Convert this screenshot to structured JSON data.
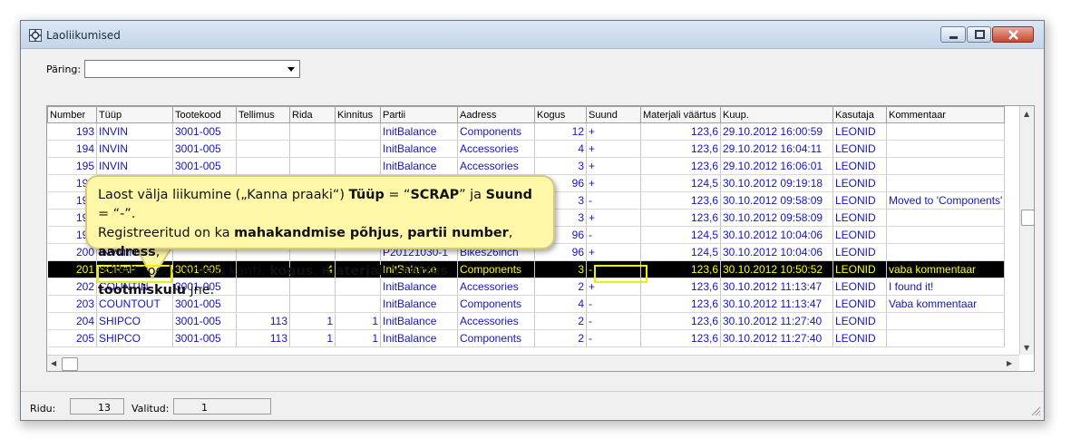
{
  "window": {
    "title": "Laoliikumised"
  },
  "query": {
    "label": "Päring:",
    "value": ""
  },
  "table": {
    "columns": [
      "Number",
      "Tüüp",
      "Tootekood",
      "Tellimus",
      "Rida",
      "Kinnitus",
      "Partii",
      "Aadress",
      "Kogus",
      "Suund",
      "Materjali väärtus",
      "Kuup.",
      "Kasutaja",
      "Kommentaar"
    ],
    "rows": [
      [
        "193",
        "INVIN",
        "3001-005",
        "",
        "",
        "",
        "InitBalance",
        "Components",
        "12",
        "+",
        "123,6",
        "29.10.2012 16:00:59",
        "LEONID",
        ""
      ],
      [
        "194",
        "INVIN",
        "3001-005",
        "",
        "",
        "",
        "InitBalance",
        "Accessories",
        "4",
        "+",
        "123,6",
        "29.10.2012 16:04:11",
        "LEONID",
        ""
      ],
      [
        "195",
        "INVIN",
        "3001-005",
        "",
        "",
        "",
        "InitBalance",
        "Accessories",
        "3",
        "+",
        "123,6",
        "29.10.2012 16:06:01",
        "LEONID",
        ""
      ],
      [
        "196",
        "",
        "",
        "",
        "",
        "",
        "",
        "",
        "96",
        "+",
        "124,5",
        "30.10.2012 09:19:18",
        "LEONID",
        ""
      ],
      [
        "197",
        "",
        "",
        "",
        "",
        "",
        "",
        "",
        "3",
        "-",
        "123,6",
        "30.10.2012 09:58:09",
        "LEONID",
        "Moved to 'Components'"
      ],
      [
        "198",
        "",
        "",
        "",
        "",
        "",
        "",
        "",
        "3",
        "+",
        "123,6",
        "30.10.2012 09:58:09",
        "LEONID",
        ""
      ],
      [
        "199",
        "",
        "",
        "",
        "",
        "",
        "",
        "",
        "96",
        "-",
        "124,5",
        "30.10.2012 10:04:06",
        "LEONID",
        ""
      ],
      [
        "200",
        "INVMIN",
        "",
        "",
        "",
        "",
        "P20121030-1",
        "Bikes26inch",
        "96",
        "+",
        "124,5",
        "30.10.2012 10:04:06",
        "LEONID",
        ""
      ],
      [
        "201",
        "SCRAP",
        "3001-005",
        "",
        "4",
        "",
        "InitBalance",
        "Components",
        "3",
        "-",
        "123,6",
        "30.10.2012 10:50:52",
        "LEONID",
        "vaba kommentaar"
      ],
      [
        "202",
        "COUNTIN",
        "3001-005",
        "",
        "",
        "",
        "InitBalance",
        "Accessories",
        "2",
        "+",
        "123,6",
        "30.10.2012 11:13:47",
        "LEONID",
        "I found it!"
      ],
      [
        "203",
        "COUNTOUT",
        "3001-005",
        "",
        "",
        "",
        "InitBalance",
        "Components",
        "4",
        "-",
        "123,6",
        "30.10.2012 11:13:47",
        "LEONID",
        "Vaba kommentaar"
      ],
      [
        "204",
        "SHIPCO",
        "3001-005",
        "113",
        "1",
        "1",
        "InitBalance",
        "Accessories",
        "2",
        "-",
        "123,6",
        "30.10.2012 11:27:40",
        "LEONID",
        ""
      ],
      [
        "205",
        "SHIPCO",
        "3001-005",
        "113",
        "1",
        "1",
        "InitBalance",
        "Components",
        "2",
        "-",
        "123,6",
        "30.10.2012 11:27:40",
        "LEONID",
        ""
      ]
    ],
    "selected_row": 8
  },
  "status": {
    "rows_label": "Ridu:",
    "rows_value": "13",
    "selected_label": "Valitud:",
    "selected_value": "1"
  },
  "callout": {
    "line1_a": "Laost välja liikumine („Kanna praaki“) ",
    "line1_b": "Tüüp",
    "line1_c": " = “",
    "line1_d": "SCRAP",
    "line1_e": "” ja ",
    "line1_f": "Suund",
    "line1_g": " = “-”.",
    "line2_a": "Registreeritud on ka ",
    "line2_b": "mahakandmise põhjus",
    "line2_c": ", ",
    "line2_d": "partii number",
    "line2_e": ", ",
    "line2_f": "aadress",
    "line2_g": ",",
    "line3_a": "millelt toode praaki kanti, ",
    "line3_b": "kogus",
    "line3_c": ", ",
    "line3_d": "materjali väärtus",
    "line3_e": ", ",
    "line3_f": "tootmiskulu",
    "line3_g": " jne."
  },
  "colors": {
    "row_text": "#1414c8",
    "selected_bg": "#000000",
    "selected_text": "#ffff00",
    "callout_bg": "#fff7a8"
  }
}
